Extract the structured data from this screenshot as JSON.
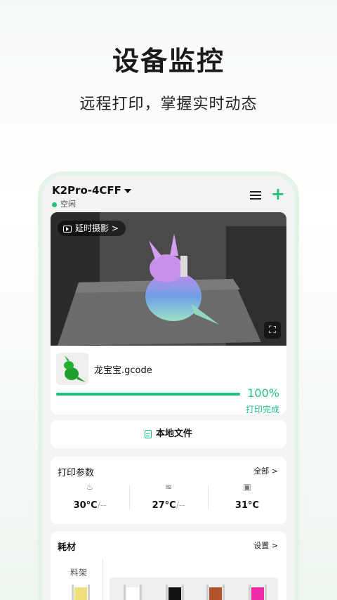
{
  "hero": {
    "title": "设备监控",
    "subtitle": "远程打印，掌握实时动态"
  },
  "device": {
    "name": "K2Pro-4CFF",
    "status": "空闲",
    "status_color": "#21c07a"
  },
  "camera": {
    "timelapse_label": "延时摄影 >"
  },
  "job": {
    "file_name": "龙宝宝.gcode",
    "progress_label": "100%",
    "progress_value": 100,
    "state": "打印完成",
    "accent": "#1fbf82"
  },
  "local_files": {
    "label": "本地文件"
  },
  "params": {
    "title": "打印参数",
    "all_label": "全部 >",
    "items": [
      {
        "icon": "nozzle-icon",
        "value": "30°C",
        "target": "/--"
      },
      {
        "icon": "heated-bed-icon",
        "value": "27°C",
        "target": "/--"
      },
      {
        "icon": "chamber-icon",
        "value": "31°C",
        "target": ""
      }
    ]
  },
  "filament": {
    "title": "耗材",
    "settings_label": "设置 >",
    "rack_label": "料架",
    "spools": [
      {
        "color": "#f0e07a"
      },
      {
        "color": "#ffffff"
      },
      {
        "color": "#111111"
      },
      {
        "color": "#b4522b"
      },
      {
        "color": "#ee2aa6"
      }
    ]
  }
}
